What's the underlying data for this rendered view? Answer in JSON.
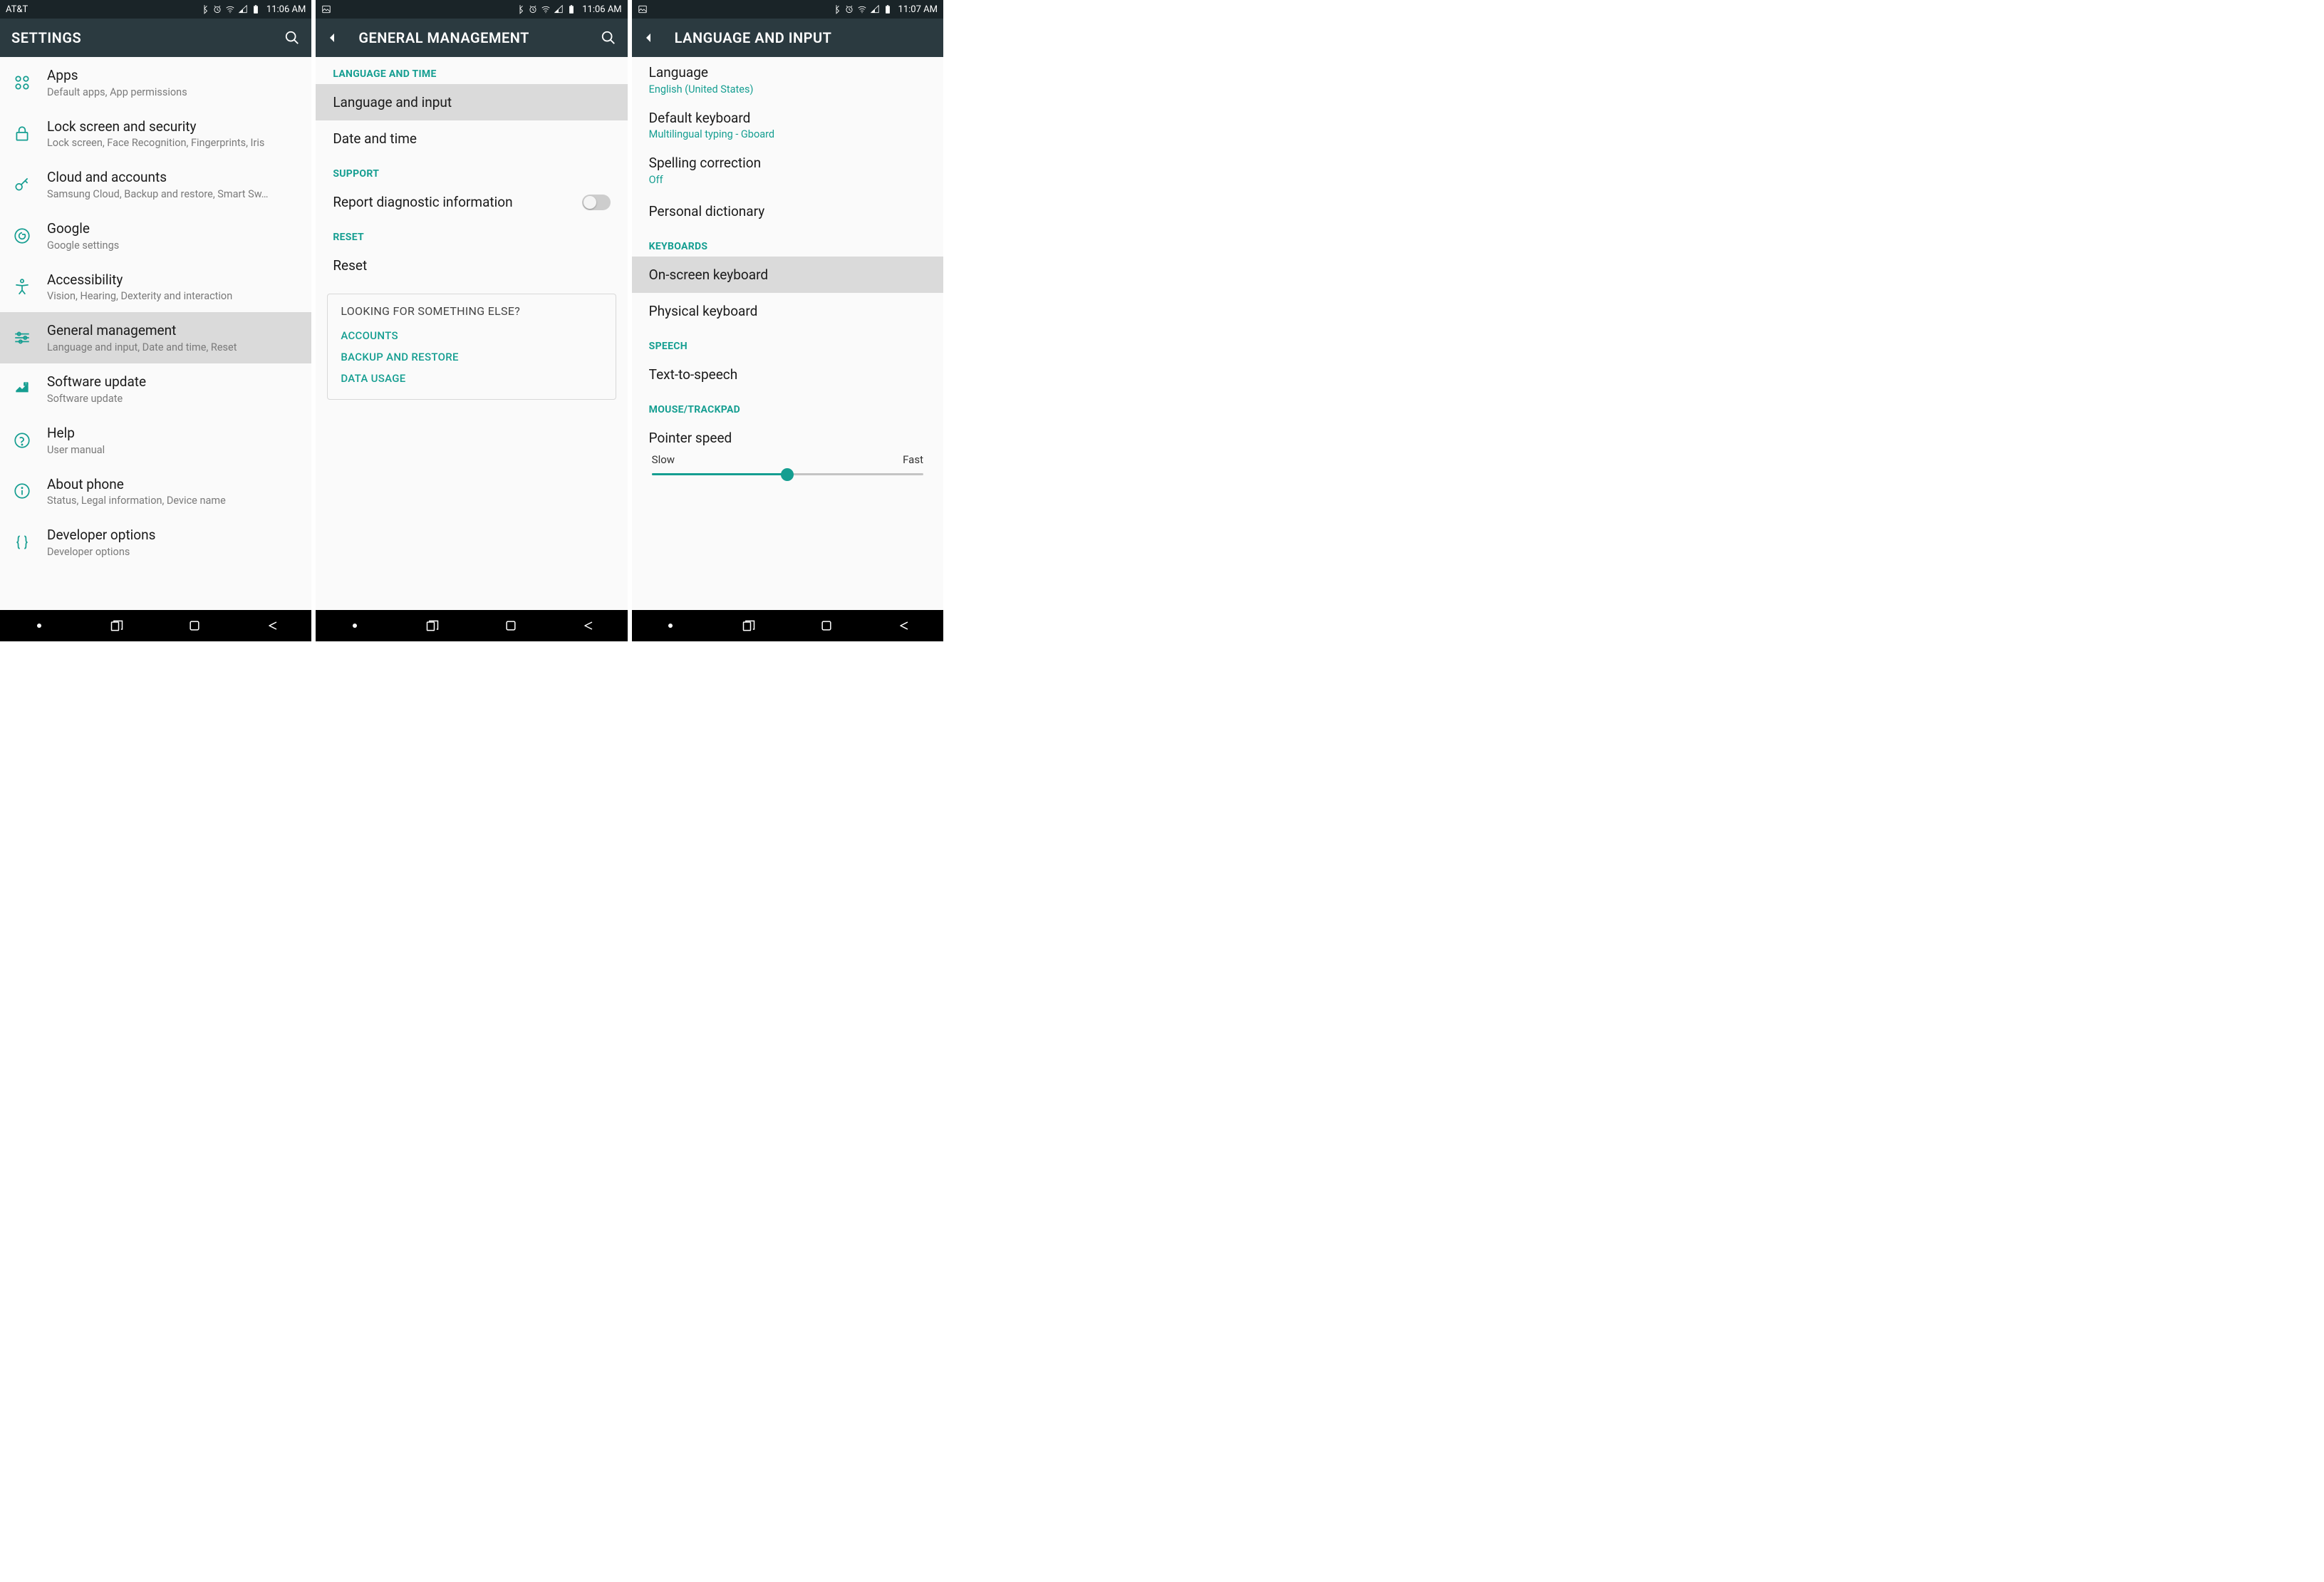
{
  "colors": {
    "teal": "#159e91",
    "header": "#2b3a40"
  },
  "screen1": {
    "status": {
      "carrier": "AT&T",
      "time": "11:06 AM"
    },
    "title": "SETTINGS",
    "items": [
      {
        "icon": "apps",
        "title": "Apps",
        "sub": "Default apps, App permissions"
      },
      {
        "icon": "lock",
        "title": "Lock screen and security",
        "sub": "Lock screen, Face Recognition, Fingerprints, Iris"
      },
      {
        "icon": "key",
        "title": "Cloud and accounts",
        "sub": "Samsung Cloud, Backup and restore, Smart Sw…"
      },
      {
        "icon": "google",
        "title": "Google",
        "sub": "Google settings"
      },
      {
        "icon": "accessibility",
        "title": "Accessibility",
        "sub": "Vision, Hearing, Dexterity and interaction"
      },
      {
        "icon": "sliders",
        "title": "General management",
        "sub": "Language and input, Date and time, Reset",
        "highlighted": true
      },
      {
        "icon": "update",
        "title": "Software update",
        "sub": "Software update"
      },
      {
        "icon": "help",
        "title": "Help",
        "sub": "User manual"
      },
      {
        "icon": "info",
        "title": "About phone",
        "sub": "Status, Legal information, Device name"
      },
      {
        "icon": "braces",
        "title": "Developer options",
        "sub": "Developer options"
      }
    ]
  },
  "screen2": {
    "status": {
      "time": "11:06 AM"
    },
    "title": "GENERAL MANAGEMENT",
    "section1": "LANGUAGE AND TIME",
    "row_lang_input": "Language and input",
    "row_date_time": "Date and time",
    "section2": "SUPPORT",
    "row_diag": "Report diagnostic information",
    "section3": "RESET",
    "row_reset": "Reset",
    "looking": {
      "title": "LOOKING FOR SOMETHING ELSE?",
      "links": [
        "ACCOUNTS",
        "BACKUP AND RESTORE",
        "DATA USAGE"
      ]
    }
  },
  "screen3": {
    "status": {
      "time": "11:07 AM"
    },
    "title": "LANGUAGE AND INPUT",
    "lang": {
      "title": "Language",
      "sub": "English (United States)"
    },
    "keyboard": {
      "title": "Default keyboard",
      "sub": "Multilingual typing - Gboard"
    },
    "spelling": {
      "title": "Spelling correction",
      "sub": "Off"
    },
    "personal_dict": "Personal dictionary",
    "section_keyboards": "KEYBOARDS",
    "onscreen": "On-screen keyboard",
    "physical": "Physical keyboard",
    "section_speech": "SPEECH",
    "tts": "Text-to-speech",
    "section_mouse": "MOUSE/TRACKPAD",
    "pointer": "Pointer speed",
    "slow": "Slow",
    "fast": "Fast"
  }
}
